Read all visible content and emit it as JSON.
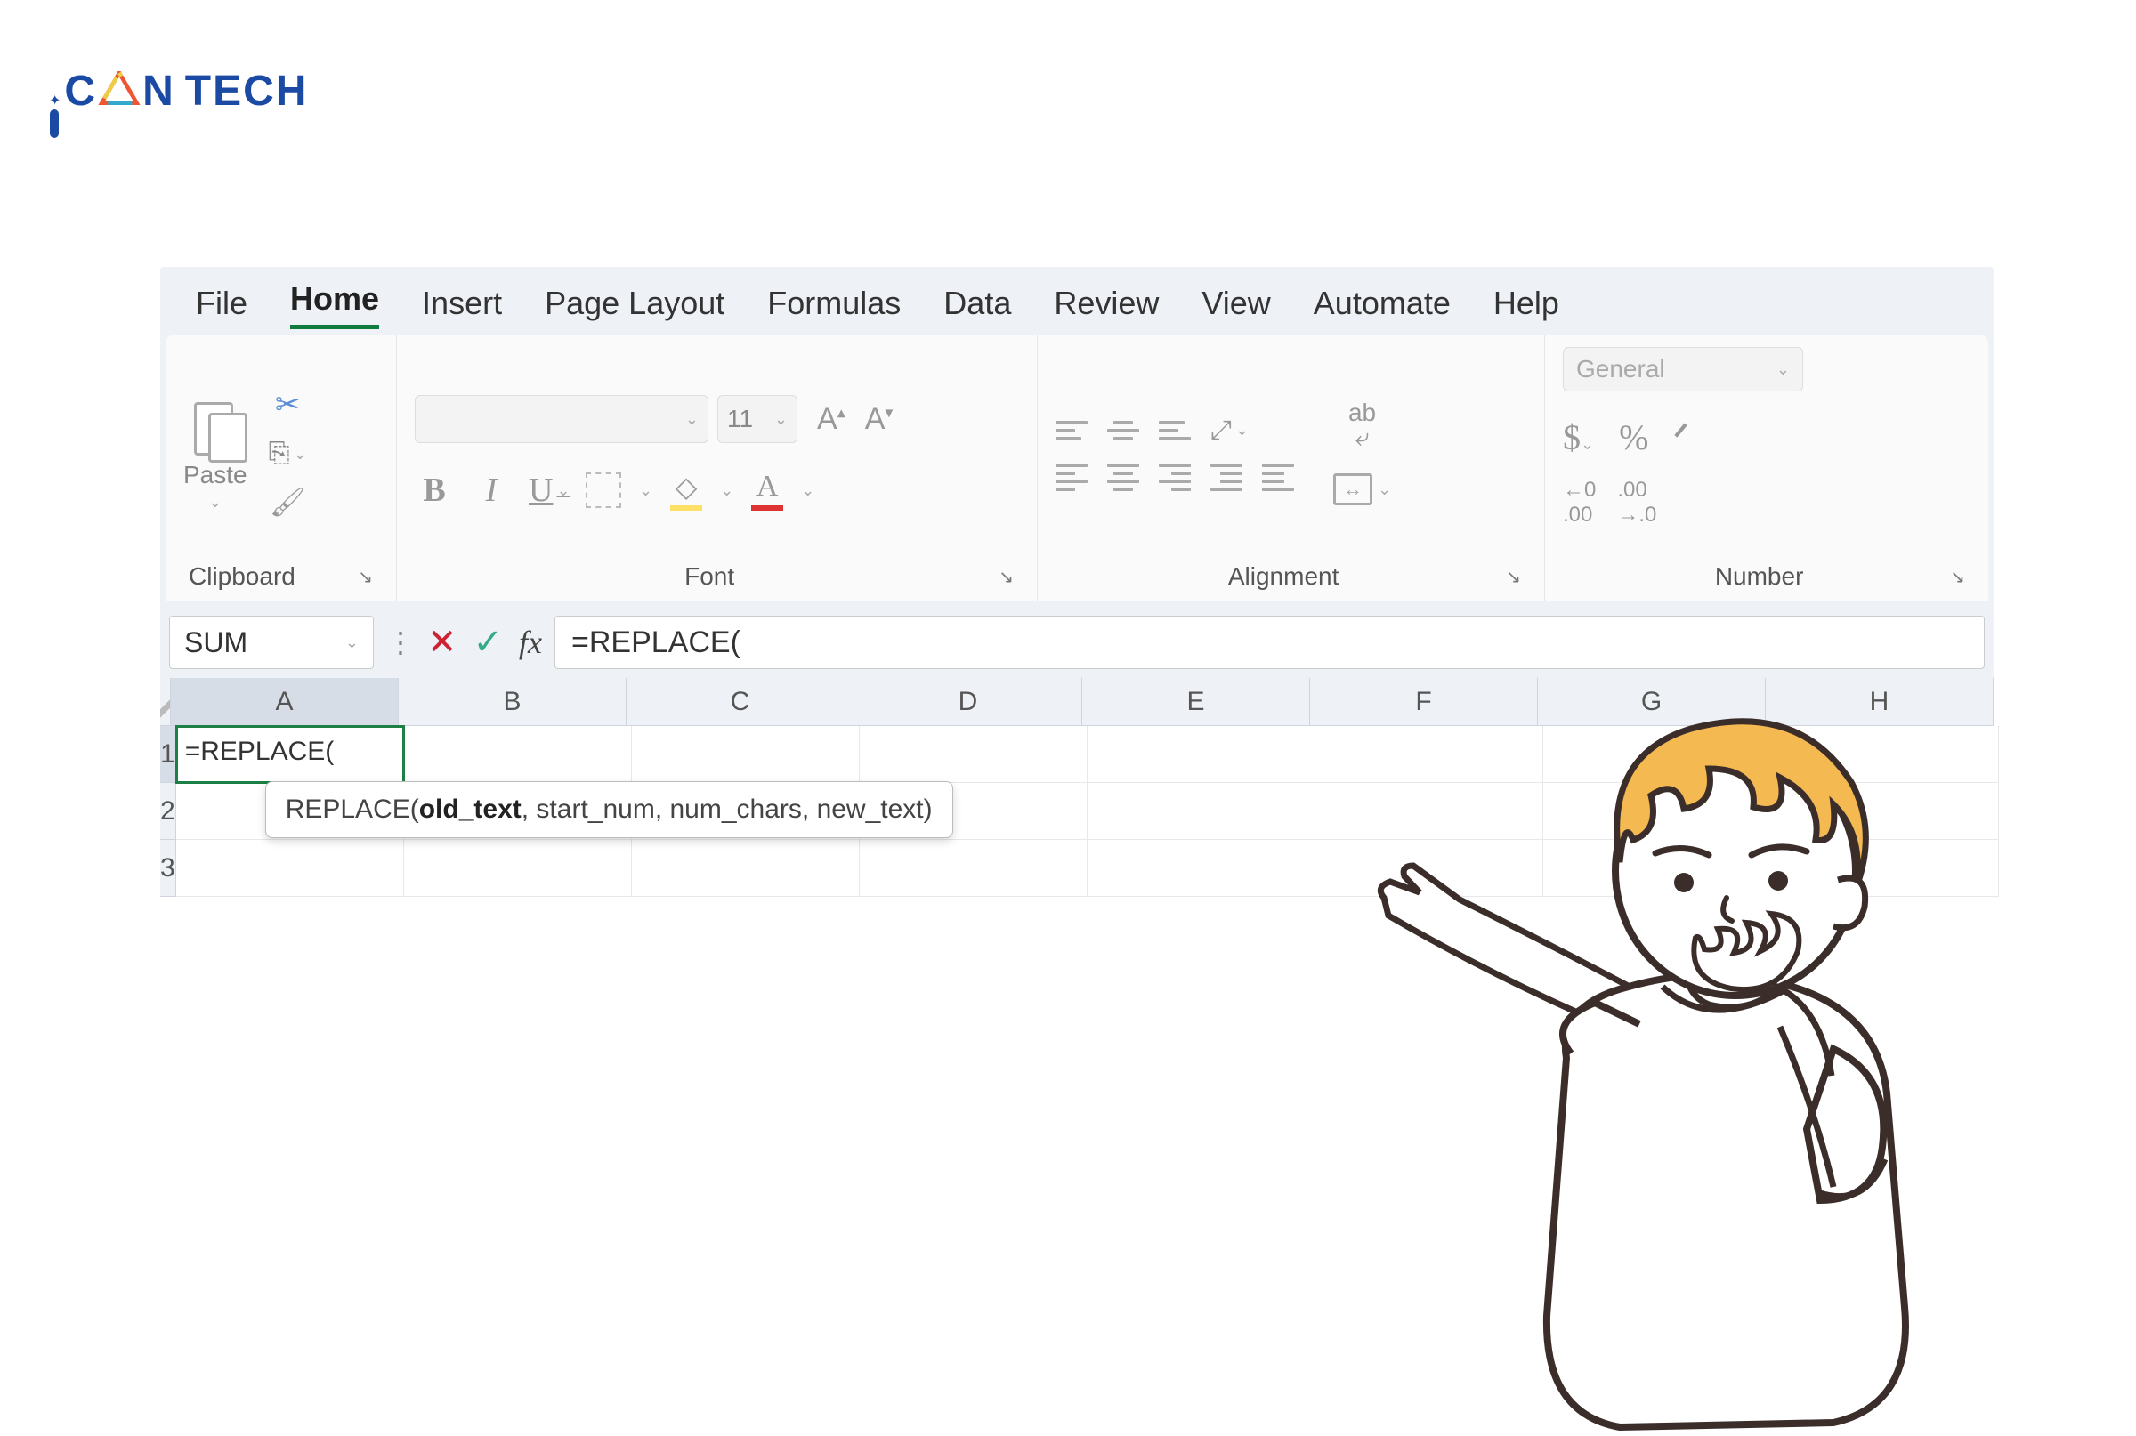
{
  "logo": {
    "c": "C",
    "n": "N",
    "tech": "TECH"
  },
  "tabs": {
    "file": "File",
    "home": "Home",
    "insert": "Insert",
    "page_layout": "Page Layout",
    "formulas": "Formulas",
    "data": "Data",
    "review": "Review",
    "view": "View",
    "automate": "Automate",
    "help": "Help"
  },
  "ribbon": {
    "clipboard": {
      "paste": "Paste",
      "label": "Clipboard"
    },
    "font": {
      "size": "11",
      "label": "Font"
    },
    "alignment": {
      "label": "Alignment"
    },
    "number": {
      "format": "General",
      "label": "Number"
    }
  },
  "formula_bar": {
    "name": "SUM",
    "formula": "=REPLACE("
  },
  "columns": [
    "A",
    "B",
    "C",
    "D",
    "E",
    "F",
    "G",
    "H"
  ],
  "rows": [
    "1",
    "2",
    "3"
  ],
  "active_cell_value": "=REPLACE(",
  "tooltip": {
    "fn": "REPLACE(",
    "arg_bold": "old_text",
    "rest": ", start_num, num_chars, new_text)"
  }
}
